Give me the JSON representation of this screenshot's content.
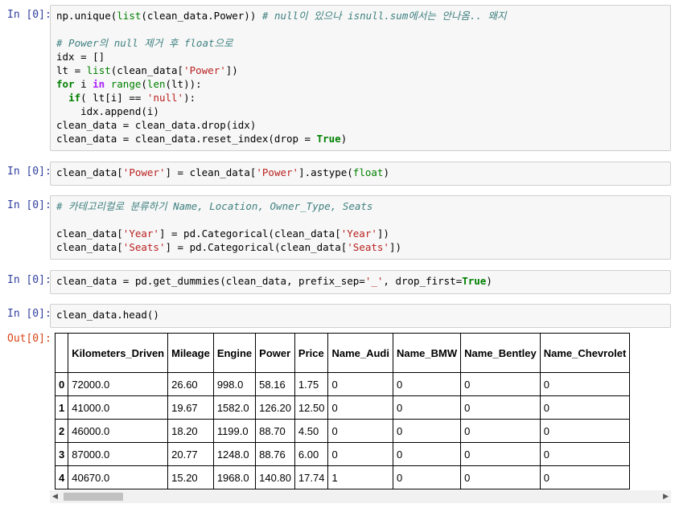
{
  "cells": [
    {
      "prompt": "In [0]:",
      "lines": [
        [
          [
            "np.unique(",
            ""
          ],
          [
            "list",
            "builtin"
          ],
          [
            "(clean_data.Power)) ",
            ""
          ],
          [
            "# null이 있으나 isnull.sum에서는 안나옴.. 왜지",
            "comment"
          ]
        ],
        [],
        [
          [
            "# Power의 null 제거 후 float으로",
            "comment"
          ]
        ],
        [
          [
            "idx = []",
            ""
          ]
        ],
        [
          [
            "lt = ",
            ""
          ],
          [
            "list",
            "builtin"
          ],
          [
            "(clean_data[",
            ""
          ],
          [
            "'Power'",
            "string"
          ],
          [
            "])",
            ""
          ]
        ],
        [
          [
            "for",
            "keyword"
          ],
          [
            " i ",
            ""
          ],
          [
            "in",
            "op"
          ],
          [
            " ",
            ""
          ],
          [
            "range",
            "builtin"
          ],
          [
            "(",
            ""
          ],
          [
            "len",
            "builtin"
          ],
          [
            "(lt)):",
            ""
          ]
        ],
        [
          [
            "  ",
            ""
          ],
          [
            "if",
            "keyword"
          ],
          [
            "( lt[i] == ",
            ""
          ],
          [
            "'null'",
            "string"
          ],
          [
            "):",
            ""
          ]
        ],
        [
          [
            "    idx.append(i)",
            ""
          ]
        ],
        [
          [
            "clean_data = clean_data.drop(idx)",
            ""
          ]
        ],
        [
          [
            "clean_data = clean_data.reset_index(drop = ",
            ""
          ],
          [
            "True",
            "keyword"
          ],
          [
            ")",
            ""
          ]
        ]
      ]
    },
    {
      "prompt": "In [0]:",
      "lines": [
        [
          [
            "clean_data[",
            ""
          ],
          [
            "'Power'",
            "string"
          ],
          [
            "] = clean_data[",
            ""
          ],
          [
            "'Power'",
            "string"
          ],
          [
            "].astype(",
            ""
          ],
          [
            "float",
            "builtin"
          ],
          [
            ")",
            ""
          ]
        ]
      ]
    },
    {
      "prompt": "In [0]:",
      "lines": [
        [
          [
            "# 카테고리컬로 분류하기 Name, Location, Owner_Type, Seats",
            "comment"
          ]
        ],
        [],
        [
          [
            "clean_data[",
            ""
          ],
          [
            "'Year'",
            "string"
          ],
          [
            "] = pd.Categorical(clean_data[",
            ""
          ],
          [
            "'Year'",
            "string"
          ],
          [
            "])",
            ""
          ]
        ],
        [
          [
            "clean_data[",
            ""
          ],
          [
            "'Seats'",
            "string"
          ],
          [
            "] = pd.Categorical(clean_data[",
            ""
          ],
          [
            "'Seats'",
            "string"
          ],
          [
            "])",
            ""
          ]
        ]
      ]
    },
    {
      "prompt": "In [0]:",
      "lines": [
        [
          [
            "clean_data = pd.get_dummies(clean_data, prefix_sep=",
            ""
          ],
          [
            "'_'",
            "string"
          ],
          [
            ", drop_first=",
            ""
          ],
          [
            "True",
            "keyword"
          ],
          [
            ")",
            ""
          ]
        ]
      ]
    },
    {
      "prompt": "In [0]:",
      "lines": [
        [
          [
            "clean_data.head()",
            ""
          ]
        ]
      ]
    }
  ],
  "output": {
    "prompt": "Out[0]:",
    "columns": [
      "Kilometers_Driven",
      "Mileage",
      "Engine",
      "Power",
      "Price",
      "Name_Audi",
      "Name_BMW",
      "Name_Bentley",
      "Name_Chevrolet"
    ],
    "rows": [
      {
        "index": "0",
        "values": [
          "72000.0",
          "26.60",
          "998.0",
          "58.16",
          "1.75",
          "0",
          "0",
          "0",
          "0"
        ]
      },
      {
        "index": "1",
        "values": [
          "41000.0",
          "19.67",
          "1582.0",
          "126.20",
          "12.50",
          "0",
          "0",
          "0",
          "0"
        ]
      },
      {
        "index": "2",
        "values": [
          "46000.0",
          "18.20",
          "1199.0",
          "88.70",
          "4.50",
          "0",
          "0",
          "0",
          "0"
        ]
      },
      {
        "index": "3",
        "values": [
          "87000.0",
          "20.77",
          "1248.0",
          "88.76",
          "6.00",
          "0",
          "0",
          "0",
          "0"
        ]
      },
      {
        "index": "4",
        "values": [
          "40670.0",
          "15.20",
          "1968.0",
          "140.80",
          "17.74",
          "1",
          "0",
          "0",
          "0"
        ]
      }
    ]
  },
  "scrollbar": {
    "left_arrow": "◀",
    "right_arrow": "▶"
  }
}
